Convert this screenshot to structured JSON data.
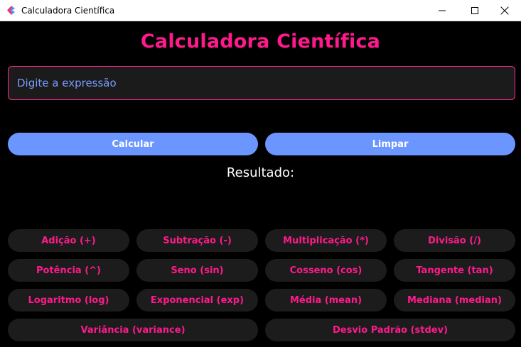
{
  "window": {
    "title": "Calculadora Científica"
  },
  "heading": "Calculadora Científica",
  "input": {
    "placeholder": "Digite a expressão",
    "value": ""
  },
  "actions": {
    "calculate_label": "Calcular",
    "clear_label": "Limpar"
  },
  "result_label": "Resultado:",
  "operations": [
    [
      "Adição (+)",
      "Subtração (-)",
      "Multiplicação (*)",
      "Divisão (/)"
    ],
    [
      "Potência (^)",
      "Seno (sin)",
      "Cosseno (cos)",
      "Tangente (tan)"
    ],
    [
      "Logaritmo (log)",
      "Exponencial (exp)",
      "Média (mean)",
      "Mediana (median)"
    ],
    [
      "Variância (variance)",
      "Desvio Padrão (stdev)"
    ]
  ],
  "colors": {
    "accent": "#ff1a8c",
    "primary_button": "#6b96ff",
    "background": "#000000",
    "operation_button": "#1c1c1c",
    "placeholder": "#7a9bff"
  },
  "icons": {
    "app": "feather-app-icon",
    "minimize": "minimize-icon",
    "maximize": "maximize-icon",
    "close": "close-icon"
  }
}
